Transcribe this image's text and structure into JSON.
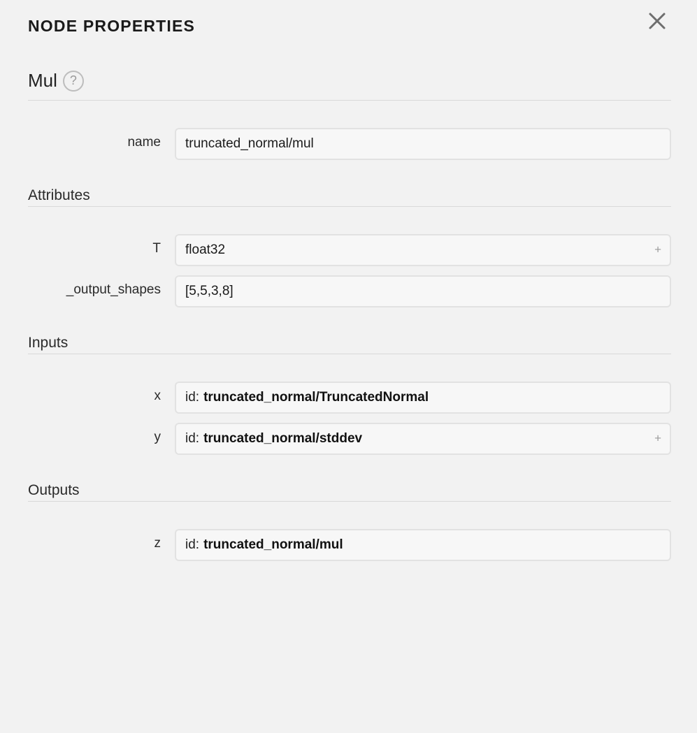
{
  "header": {
    "title": "NODE PROPERTIES",
    "close_icon": "close-icon"
  },
  "node": {
    "type": "Mul",
    "help_icon_glyph": "?",
    "name_label": "name",
    "name_value": "truncated_normal/mul"
  },
  "attributes": {
    "section_title": "Attributes",
    "items": [
      {
        "label": "T",
        "value": "float32",
        "expandable": true,
        "expand_glyph": "+"
      },
      {
        "label": "_output_shapes",
        "value": "[5,5,3,8]",
        "expandable": false
      }
    ]
  },
  "inputs": {
    "section_title": "Inputs",
    "items": [
      {
        "label": "x",
        "prefix": "id:",
        "value": "truncated_normal/TruncatedNormal",
        "expandable": false
      },
      {
        "label": "y",
        "prefix": "id:",
        "value": "truncated_normal/stddev",
        "expandable": true,
        "expand_glyph": "+"
      }
    ]
  },
  "outputs": {
    "section_title": "Outputs",
    "items": [
      {
        "label": "z",
        "prefix": "id:",
        "value": "truncated_normal/mul",
        "expandable": false
      }
    ]
  }
}
